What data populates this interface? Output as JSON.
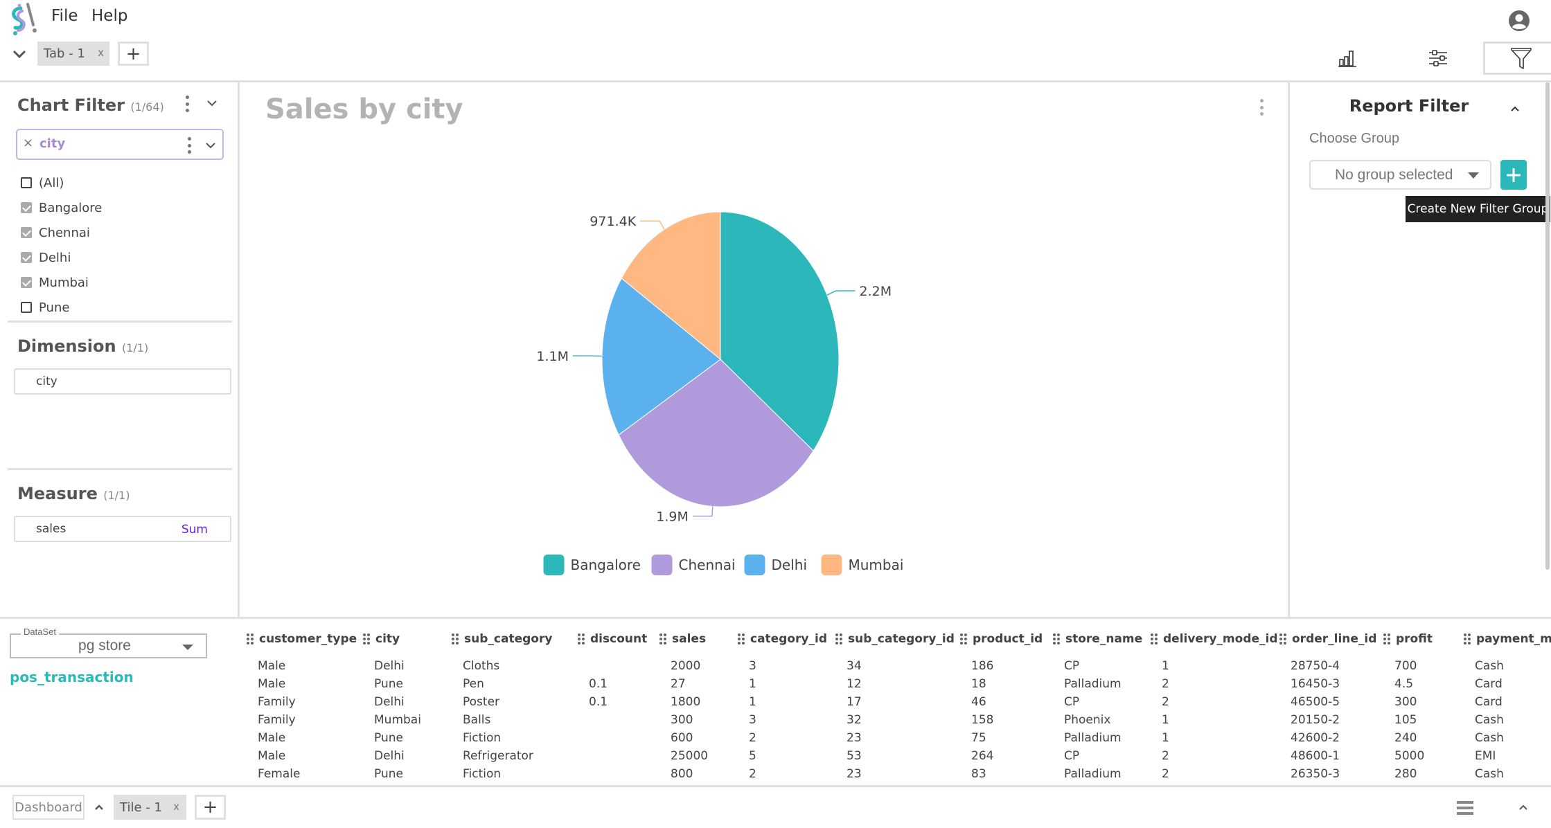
{
  "menu": {
    "file": "File",
    "help": "Help"
  },
  "tabs": [
    {
      "label": "Tab - 1",
      "close": "x"
    }
  ],
  "add_tab_label": "+",
  "toolbar": {
    "icons": [
      "chart-icon",
      "sliders-icon",
      "filter-icon"
    ],
    "active": "filter-icon"
  },
  "left_panel": {
    "chart_filter": {
      "title": "Chart Filter",
      "count": "(1/64)",
      "field": {
        "clear": "×",
        "value": "city"
      },
      "options": [
        {
          "label": "(All)",
          "checked": false
        },
        {
          "label": "Bangalore",
          "checked": true
        },
        {
          "label": "Chennai",
          "checked": true
        },
        {
          "label": "Delhi",
          "checked": true
        },
        {
          "label": "Mumbai",
          "checked": true
        },
        {
          "label": "Pune",
          "checked": false
        }
      ]
    },
    "dimension": {
      "title": "Dimension",
      "count": "(1/1)",
      "field": "city"
    },
    "measure": {
      "title": "Measure",
      "count": "(1/1)",
      "field": "sales",
      "aggregation": "Sum"
    }
  },
  "chart_data": {
    "type": "pie",
    "title": "Sales by city",
    "categories": [
      "Bangalore",
      "Chennai",
      "Delhi",
      "Mumbai"
    ],
    "values": [
      2200000,
      1900000,
      1100000,
      971400
    ],
    "labels": [
      "2.2M",
      "1.9M",
      "1.1M",
      "971.4K"
    ],
    "colors": [
      "#2cb8ba",
      "#b09adb",
      "#5bb0ee",
      "#ffb882"
    ],
    "legend": "bottom",
    "start_angle_deg": 0,
    "direction": "clockwise"
  },
  "right_panel": {
    "title": "Report Filter",
    "choose_group_label": "Choose Group",
    "group_select_value": "No group selected",
    "add_button_label": "+",
    "tooltip": "Create New Filter Group",
    "accent": "#2ab8b8"
  },
  "dataset": {
    "legend": "DataSet",
    "value": "pg store",
    "table_name": "pos_transaction"
  },
  "table": {
    "columns": [
      "customer_type",
      "city",
      "sub_category",
      "discount",
      "sales",
      "category_id",
      "sub_category_id",
      "product_id",
      "store_name",
      "delivery_mode_id",
      "order_line_id",
      "profit",
      "payment_m"
    ],
    "rows": [
      [
        "Male",
        "Delhi",
        "Cloths",
        "",
        "2000",
        "3",
        "34",
        "186",
        "CP",
        "1",
        "28750-4",
        "700",
        "Cash"
      ],
      [
        "Male",
        "Pune",
        "Pen",
        "0.1",
        "27",
        "1",
        "12",
        "18",
        "Palladium",
        "2",
        "16450-3",
        "4.5",
        "Card"
      ],
      [
        "Family",
        "Delhi",
        "Poster",
        "0.1",
        "1800",
        "1",
        "17",
        "46",
        "CP",
        "2",
        "46500-5",
        "300",
        "Card"
      ],
      [
        "Family",
        "Mumbai",
        "Balls",
        "",
        "300",
        "3",
        "32",
        "158",
        "Phoenix",
        "1",
        "20150-2",
        "105",
        "Cash"
      ],
      [
        "Male",
        "Pune",
        "Fiction",
        "",
        "600",
        "2",
        "23",
        "75",
        "Palladium",
        "1",
        "42600-2",
        "240",
        "Cash"
      ],
      [
        "Male",
        "Delhi",
        "Refrigerator",
        "",
        "25000",
        "5",
        "53",
        "264",
        "CP",
        "2",
        "48600-1",
        "5000",
        "EMI"
      ],
      [
        "Female",
        "Pune",
        "Fiction",
        "",
        "800",
        "2",
        "23",
        "83",
        "Palladium",
        "2",
        "26350-3",
        "280",
        "Cash"
      ]
    ]
  },
  "footer": {
    "dashboard_label": "Dashboard",
    "tiles": [
      {
        "label": "Tile - 1",
        "close": "x"
      }
    ],
    "add_tile_label": "+"
  }
}
